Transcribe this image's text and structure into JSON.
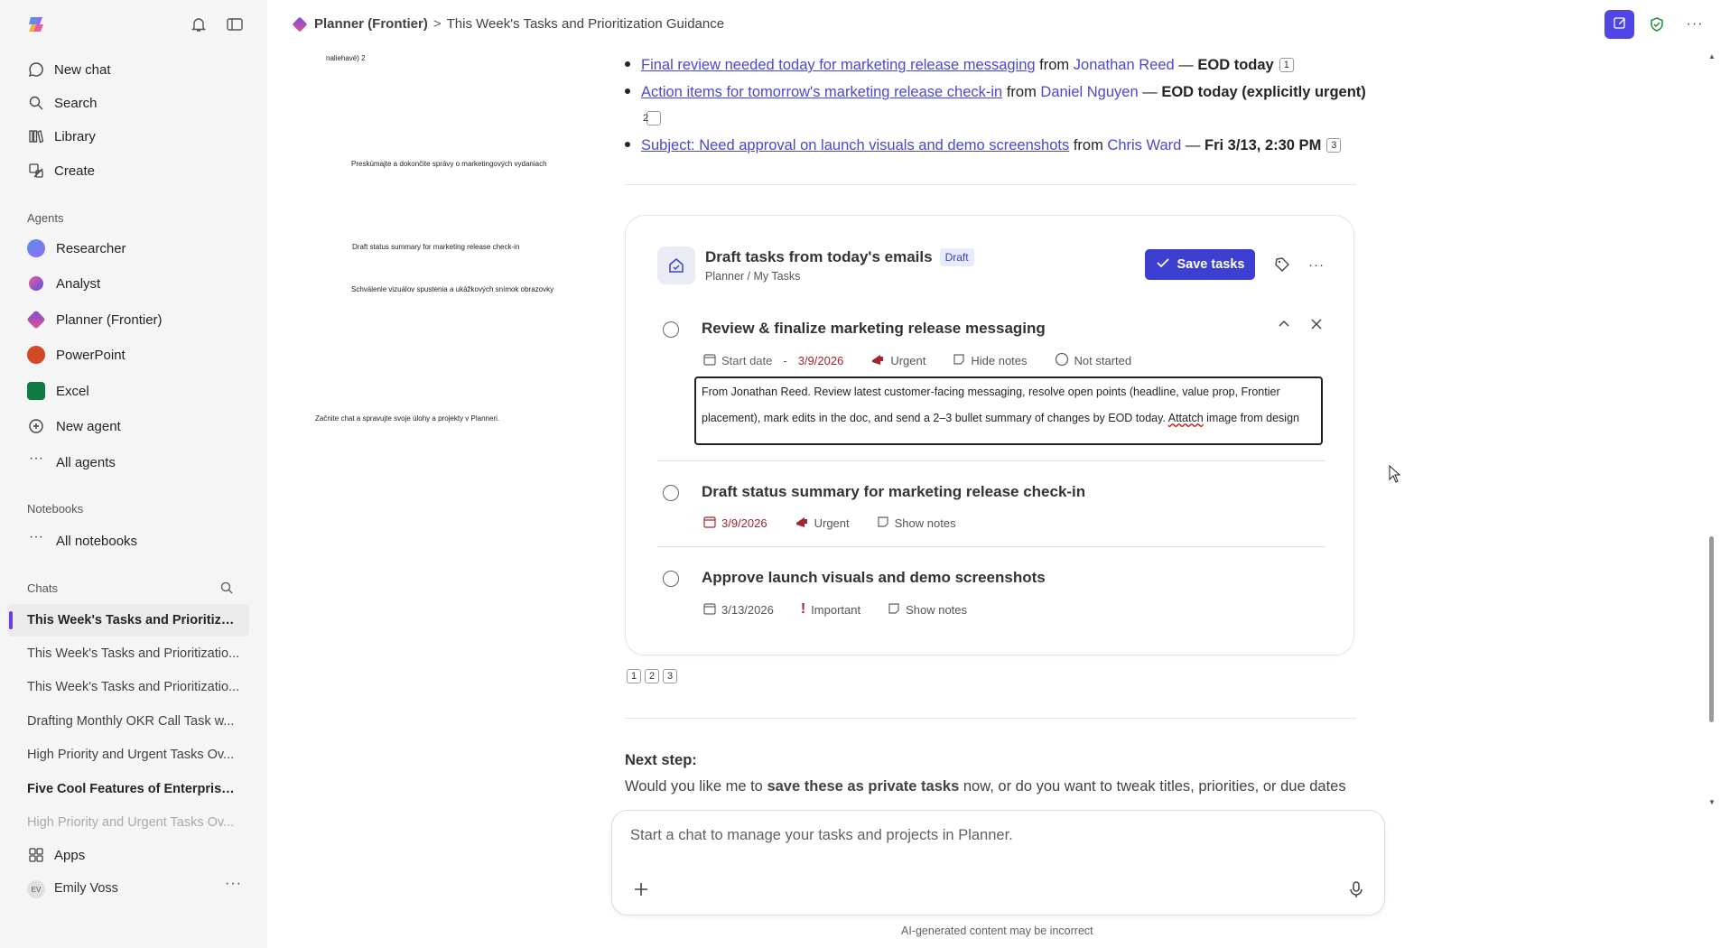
{
  "header": {
    "app_name": "Planner (Frontier)",
    "separator": ">",
    "chat_title": "This Week's Tasks and Prioritization Guidance"
  },
  "sidebar": {
    "nav": [
      {
        "label": "New chat",
        "icon": "chat-bubble-icon"
      },
      {
        "label": "Search",
        "icon": "search-icon"
      },
      {
        "label": "Library",
        "icon": "library-icon"
      },
      {
        "label": "Create",
        "icon": "create-icon"
      }
    ],
    "agents_label": "Agents",
    "agents": [
      {
        "label": "Researcher",
        "color": "#3b82f6"
      },
      {
        "label": "Analyst",
        "color": "#7c3aed"
      },
      {
        "label": "Planner (Frontier)",
        "color": "#8b5cf6"
      },
      {
        "label": "PowerPoint",
        "color": "#d24726"
      },
      {
        "label": "Excel",
        "color": "#107c41"
      },
      {
        "label": "New agent",
        "color": "#616161"
      },
      {
        "label": "All agents",
        "color": "#616161"
      }
    ],
    "notebooks_label": "Notebooks",
    "all_notebooks": "All notebooks",
    "chats_label": "Chats",
    "chats": [
      "This Week's Tasks and Prioritizati...",
      "This Week's Tasks and Prioritizatio...",
      "This Week's Tasks and Prioritizatio...",
      "Drafting Monthly OKR Call Task w...",
      "High Priority and Urgent Tasks Ov...",
      "Five Cool Features of Enterprise ...",
      "High Priority and Urgent Tasks Ov..."
    ],
    "apps_label": "Apps",
    "user_initials": "EV",
    "user_name": "Emily Voss",
    "more": "..."
  },
  "preview": {
    "line1": "naliehavé) 2",
    "line2": "Preskúmajte a dokončite správy o marketingových vydaniach",
    "line3": "Draft status summary for marketing release check-in",
    "line4": "Schválenie vizuálov spustenia a ukážkových snímok obrazovky",
    "line5": "Začnite chat a spravujte svoje úlohy a projekty v Planneri."
  },
  "bullets": [
    {
      "link": "Final review needed today for marketing release messaging",
      "from": "from",
      "person": "Jonathan Reed",
      "dash": "—",
      "due": "EOD today",
      "cite": "1"
    },
    {
      "link": "Action items for tomorrow's marketing release check-in",
      "from": "from",
      "person": "Daniel Nguyen",
      "dash": "—",
      "due": "EOD today (explicitly urgent)",
      "cite": "2"
    },
    {
      "link": "Subject: Need approval on launch visuals and demo screenshots",
      "from": "from",
      "person": "Chris Ward",
      "dash": "—",
      "due": "Fri 3/13, 2:30 PM",
      "cite": "3"
    }
  ],
  "card": {
    "title": "Draft tasks from today's emails",
    "badge": "Draft",
    "subtitle": "Planner / My Tasks",
    "save_label": "Save tasks",
    "tasks": [
      {
        "title": "Review & finalize marketing release messaging",
        "start_label": "Start date",
        "date_sep": "-",
        "due": "3/9/2026",
        "priority": "Urgent",
        "notes_toggle": "Hide notes",
        "status": "Not started",
        "notes_line1": "From Jonathan Reed. Review latest customer-facing messaging, resolve open points (headline, value prop, Frontier",
        "notes_line2_a": "placement), mark edits in the doc, and send a 2–3 bullet summary of changes by EOD today.",
        "notes_line2_b": "Attatch",
        "notes_line2_c": "image from design"
      },
      {
        "title": "Draft status summary for marketing release check-in",
        "due": "3/9/2026",
        "priority": "Urgent",
        "notes_toggle": "Show notes"
      },
      {
        "title": "Approve launch visuals and demo screenshots",
        "due": "3/13/2026",
        "priority": "Important",
        "notes_toggle": "Show notes"
      }
    ]
  },
  "citations": [
    "1",
    "2",
    "3"
  ],
  "next_step": {
    "heading": "Next step:",
    "text_a": "Would you like me to",
    "text_bold": "save these as private tasks",
    "text_b": "now, or do you want to tweak titles, priorities, or due dates"
  },
  "composer": {
    "placeholder": "Start a chat to manage your tasks and projects in Planner."
  },
  "disclaimer": "AI-generated content may be incorrect",
  "colors": {
    "accent": "#3d3fd1",
    "link": "#4a47d1",
    "urgent": "#a4262c"
  }
}
